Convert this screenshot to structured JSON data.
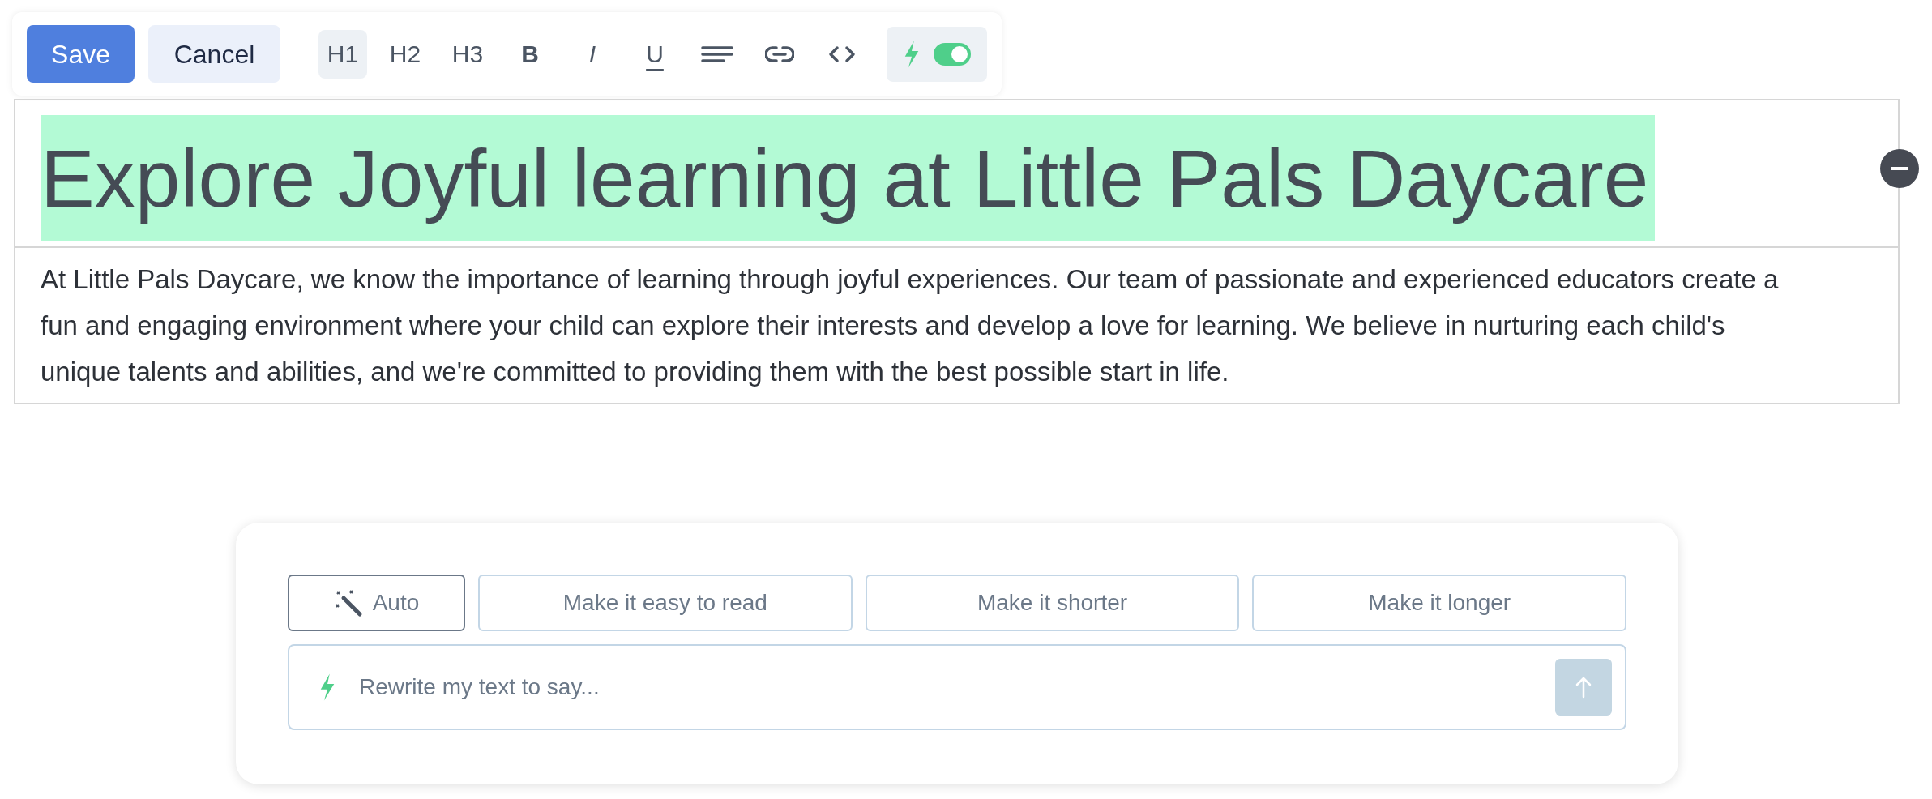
{
  "toolbar": {
    "save": "Save",
    "cancel": "Cancel",
    "tools": [
      {
        "kind": "text",
        "label": "H1",
        "selected": true
      },
      {
        "kind": "text",
        "label": "H2",
        "selected": false
      },
      {
        "kind": "text",
        "label": "H3",
        "selected": false
      },
      {
        "kind": "bold",
        "label": "B",
        "selected": false
      },
      {
        "kind": "italic",
        "label": "I",
        "selected": false
      },
      {
        "kind": "underline",
        "label": "U",
        "selected": false
      },
      {
        "kind": "align",
        "selected": false
      },
      {
        "kind": "link",
        "selected": false
      },
      {
        "kind": "code",
        "selected": false
      }
    ],
    "ai_toggle": {
      "on": true
    }
  },
  "heading": {
    "text": "Explore Joyful learning at Little Pals Daycare",
    "highlighted": true
  },
  "paragraph": "At Little Pals Daycare, we know the importance of learning through joyful experiences. Our team of passionate and experienced educators create a fun and engaging environment where your child can explore their interests and develop a love for learning. We believe in nurturing each child's unique talents and abilities, and we're committed to providing them with the best possible start in life.",
  "assistant": {
    "chips": [
      {
        "label": "Auto",
        "selected": true
      },
      {
        "label": "Make it easy to read",
        "selected": false
      },
      {
        "label": "Make it shorter",
        "selected": false
      },
      {
        "label": "Make it longer",
        "selected": false
      }
    ],
    "prompt": {
      "placeholder": "Rewrite my text to say..."
    }
  }
}
